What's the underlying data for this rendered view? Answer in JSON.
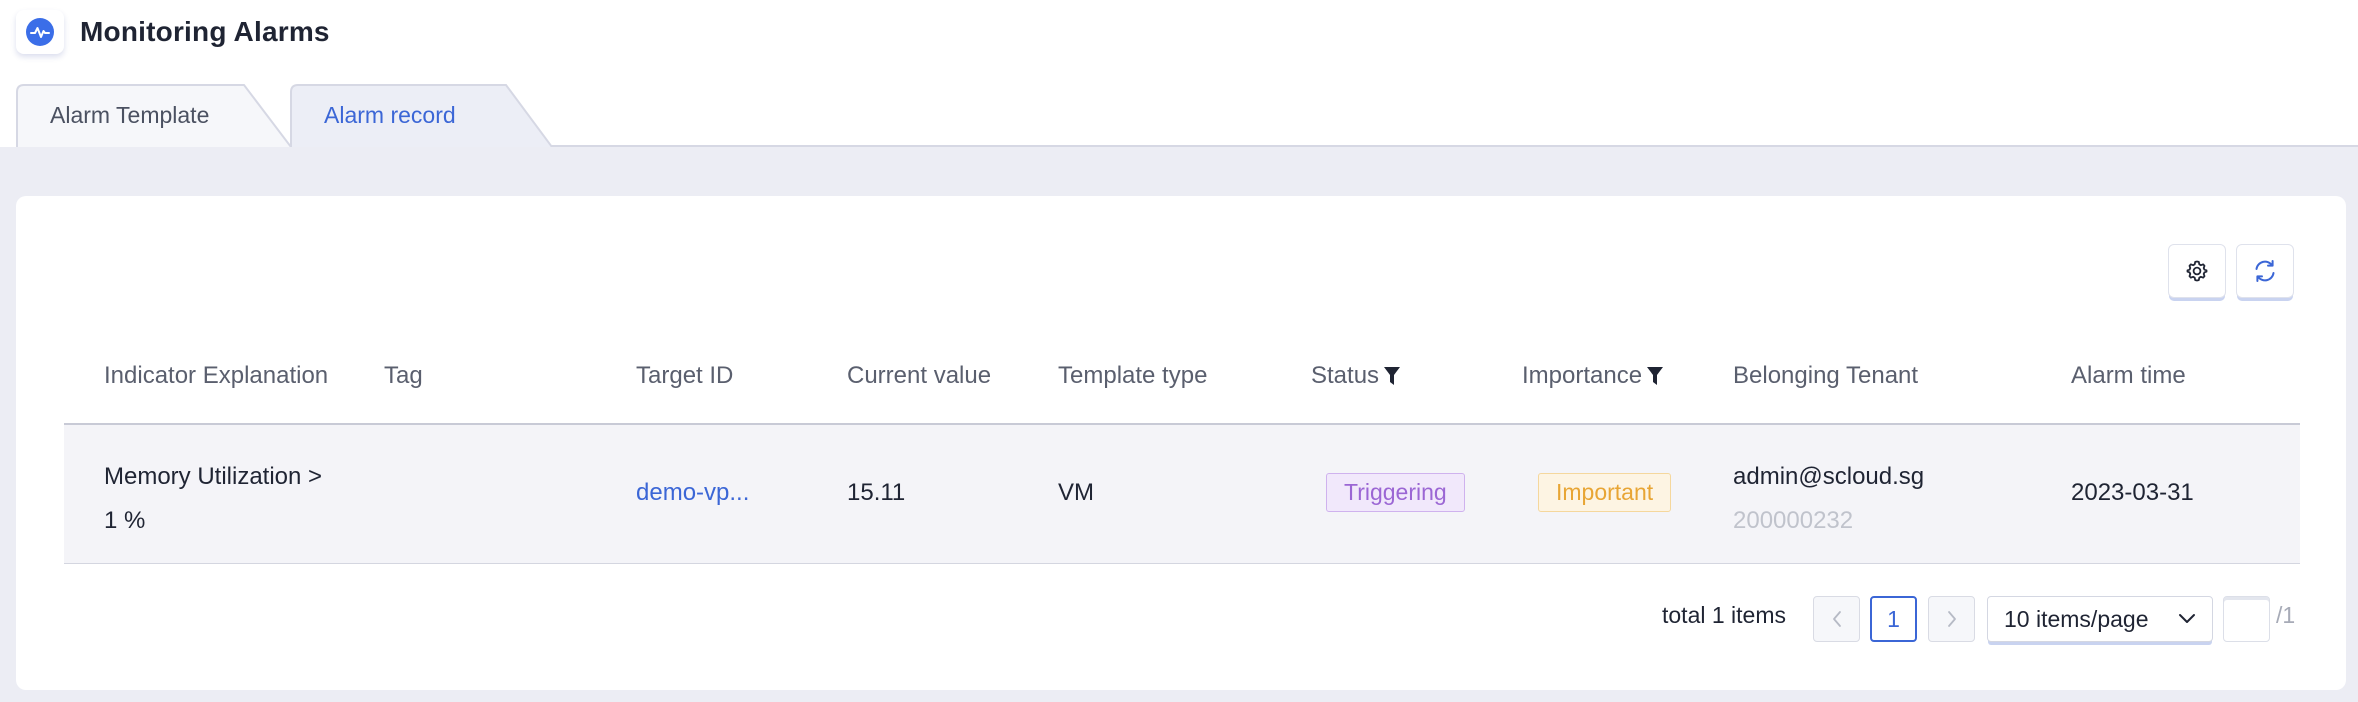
{
  "header": {
    "title": "Monitoring Alarms",
    "icon": "activity-icon"
  },
  "tabs": [
    {
      "label": "Alarm Template",
      "active": false
    },
    {
      "label": "Alarm record",
      "active": true
    }
  ],
  "toolbar": {
    "settings_icon": "gear-icon",
    "refresh_icon": "refresh-icon"
  },
  "table": {
    "columns": [
      "Indicator Explanation",
      "Tag",
      "Target ID",
      "Current value",
      "Template type",
      "Status",
      "Importance",
      "Belonging Tenant",
      "Alarm time"
    ],
    "rows": [
      {
        "indicator_line1": "Memory Utilization >",
        "indicator_line2": "1 %",
        "tag": "",
        "target_id": "demo-vp...",
        "current_value": "15.11",
        "template_type": "VM",
        "status": "Triggering",
        "importance": "Important",
        "tenant": "admin@scloud.sg",
        "tenant_id": "200000232",
        "alarm_time": "2023-03-31"
      }
    ]
  },
  "pagination": {
    "total": "total 1 items",
    "prev": "<",
    "current": "1",
    "next": ">",
    "page_size": "10 items/page",
    "jump_value": "",
    "of_total": "/1"
  },
  "colors": {
    "accent": "#3b66d6",
    "status_text": "#9b66d4",
    "importance_text": "#e8a534"
  }
}
